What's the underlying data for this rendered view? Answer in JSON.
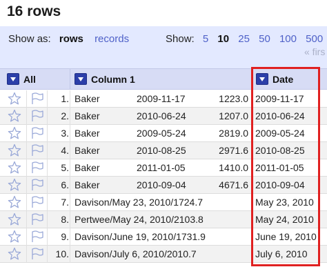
{
  "page": {
    "title": "16 rows"
  },
  "view_panel": {
    "show_as_label": "Show as:",
    "rows_label": "rows",
    "records_label": "records",
    "show_label": "Show:",
    "page_size_options": [
      "5",
      "10",
      "25",
      "50",
      "100",
      "500"
    ],
    "selected_page_size": "10",
    "first_label": "« firs"
  },
  "header": {
    "all_label": "All",
    "column1_label": "Column 1",
    "date_label": "Date"
  },
  "rows": [
    {
      "num": "1.",
      "name": "Baker",
      "date": "2009-11-17",
      "value": "1223.0",
      "date_col": "2009-11-17"
    },
    {
      "num": "2.",
      "name": "Baker",
      "date": "2010-06-24",
      "value": "1207.0",
      "date_col": "2010-06-24"
    },
    {
      "num": "3.",
      "name": "Baker",
      "date": "2009-05-24",
      "value": "2819.0",
      "date_col": "2009-05-24"
    },
    {
      "num": "4.",
      "name": "Baker",
      "date": "2010-08-25",
      "value": "2971.6",
      "date_col": "2010-08-25"
    },
    {
      "num": "5.",
      "name": "Baker",
      "date": "2011-01-05",
      "value": "1410.0",
      "date_col": "2011-01-05"
    },
    {
      "num": "6.",
      "name": "Baker",
      "date": "2010-09-04",
      "value": "4671.6",
      "date_col": "2010-09-04"
    },
    {
      "num": "7.",
      "full": "Davison/May 23, 2010/1724.7",
      "date_col": "May 23, 2010"
    },
    {
      "num": "8.",
      "full": "Pertwee/May 24, 2010/2103.8",
      "date_col": "May 24, 2010"
    },
    {
      "num": "9.",
      "full": "Davison/June 19, 2010/1731.9",
      "date_col": "June 19, 2010"
    },
    {
      "num": "10.",
      "full": "Davison/July 6, 2010/2010.7",
      "date_col": "July 6, 2010"
    }
  ],
  "colors": {
    "accent": "#4f61c8",
    "header_bg": "#d7dcf5",
    "panel_bg": "#e3e9ff",
    "highlight": "#e02020"
  },
  "icons": {
    "star": "star-icon",
    "flag": "flag-icon",
    "dropdown": "dropdown-arrow-icon"
  }
}
